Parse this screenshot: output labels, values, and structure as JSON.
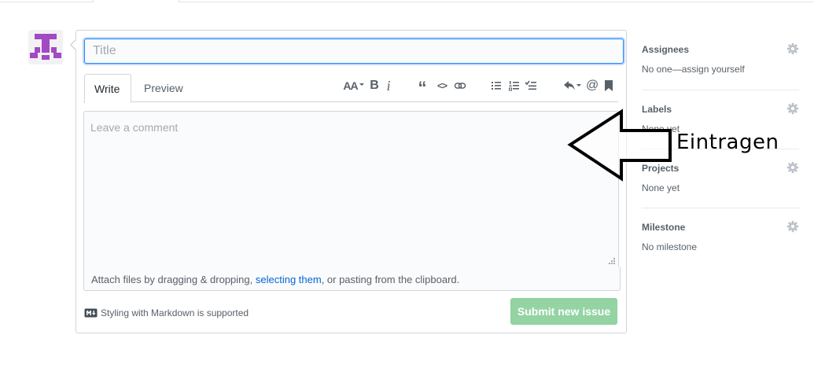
{
  "issue_form": {
    "title_placeholder": "Title",
    "tabs": {
      "write": "Write",
      "preview": "Preview"
    },
    "toolbar": {
      "heading": "AA",
      "bold": "B",
      "italic": "i",
      "quote": "“",
      "code": "<>",
      "link_icon": "link-icon",
      "unordered_list_icon": "unordered-list-icon",
      "ordered_list_icon": "ordered-list-icon",
      "task_list_icon": "task-list-icon",
      "reply_icon": "reply-icon",
      "mention": "@",
      "saved_reply_icon": "bookmark-icon"
    },
    "comment_placeholder": "Leave a comment",
    "attach": {
      "before": "Attach files by dragging & dropping, ",
      "link": "selecting them",
      "after": ", or pasting from the clipboard."
    },
    "markdown_note": "Styling with Markdown is supported",
    "submit_label": "Submit new issue"
  },
  "sidebar": {
    "sections": [
      {
        "title": "Assignees",
        "value": "No one—assign yourself"
      },
      {
        "title": "Labels",
        "value": "None yet"
      },
      {
        "title": "Projects",
        "value": "None yet"
      },
      {
        "title": "Milestone",
        "value": "No milestone"
      }
    ]
  },
  "annotation": {
    "label": "Eintragen"
  },
  "colors": {
    "accent": "#0366d6",
    "submit": "#94d3a2",
    "avatar": "#a249c3",
    "focus": "#2188ff"
  }
}
